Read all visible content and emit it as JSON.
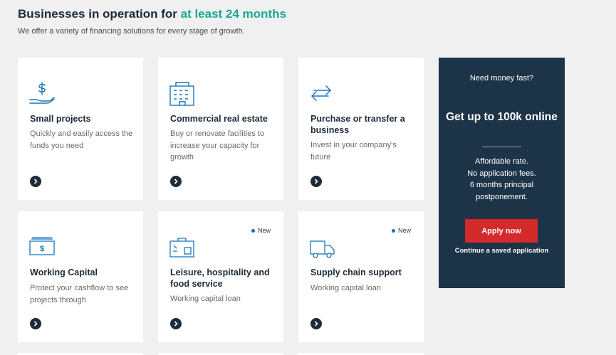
{
  "header": {
    "title_prefix": "Businesses in operation for ",
    "title_accent": "at least 24 months",
    "subtitle": "We offer a variety of financing solutions for every stage of growth."
  },
  "cards": [
    {
      "icon": "dollar-hand-icon",
      "title": "Small projects",
      "desc": "Quickly and easily access the funds you need",
      "new": ""
    },
    {
      "icon": "building-icon",
      "title": "Commercial real estate",
      "desc": "Buy or renovate facilities to increase your capacity for growth",
      "new": ""
    },
    {
      "icon": "transfer-arrows-icon",
      "title": "Purchase or transfer a business",
      "desc": "Invest in your company's future",
      "new": ""
    },
    {
      "icon": "cash-icon",
      "title": "Working Capital",
      "desc": "Protect your cashflow to see projects through",
      "new": ""
    },
    {
      "icon": "suitcase-icon",
      "title": "Leisure, hospitality and food service",
      "desc": "Working capital loan",
      "new": "New"
    },
    {
      "icon": "truck-icon",
      "title": "Supply chain support",
      "desc": "Working capital loan",
      "new": "New"
    }
  ],
  "promo": {
    "question": "Need money fast?",
    "headline": "Get up to 100k online",
    "features": [
      "Affordable rate.",
      "No application fees.",
      "6 months principal postponement."
    ],
    "apply_label": "Apply now",
    "continue_label": "Continue a saved application"
  },
  "colors": {
    "accent": "#1aa89a",
    "navy": "#1d3448",
    "apply": "#d42a2a",
    "icon_blue": "#1b75bc"
  }
}
